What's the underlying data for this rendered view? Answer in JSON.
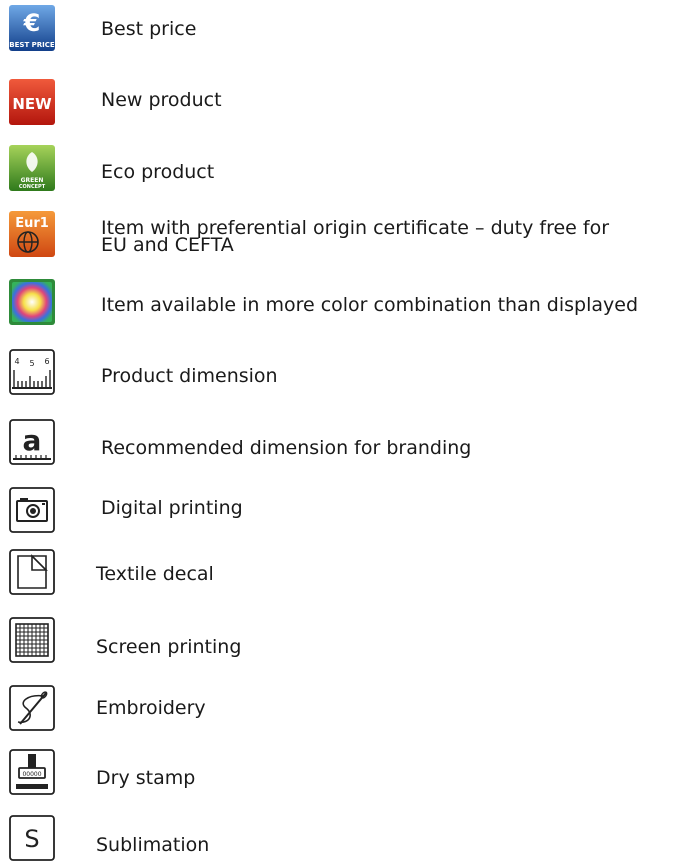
{
  "legend": {
    "items": [
      {
        "label": "Best price",
        "icon": "best-price-badge-icon",
        "icon_text": "BEST PRICE",
        "color": "#1f5fb4"
      },
      {
        "label": "New product",
        "icon": "new-badge-icon",
        "icon_text": "NEW",
        "color": "#d42a1e"
      },
      {
        "label": "Eco product",
        "icon": "green-concept-badge-icon",
        "icon_text": "GREEN CONCEPT",
        "color": "#5aa02c"
      },
      {
        "label": "Item with preferential origin certificate – duty free for\nEU and CEFTA",
        "icon": "eur1-certificate-icon",
        "icon_text": "Eur1",
        "color": "#e8671b"
      },
      {
        "label": "Item available in more color combination than displayed",
        "icon": "color-palette-icon",
        "color": "#2e8b3a"
      },
      {
        "label": "Product dimension",
        "icon": "ruler-icon",
        "icon_text": "4 5 6"
      },
      {
        "label": "Recommended dimension for branding",
        "icon": "branding-dimension-icon",
        "icon_text": "a"
      },
      {
        "label": "Digital printing",
        "icon": "camera-icon"
      },
      {
        "label": "Textile decal",
        "icon": "decal-sheet-icon"
      },
      {
        "label": "Screen printing",
        "icon": "screen-grid-icon"
      },
      {
        "label": "Embroidery",
        "icon": "needle-thread-icon"
      },
      {
        "label": "Dry stamp",
        "icon": "stamp-icon"
      },
      {
        "label": "Sublimation",
        "icon": "sublimation-icon",
        "icon_text": "S"
      }
    ]
  }
}
